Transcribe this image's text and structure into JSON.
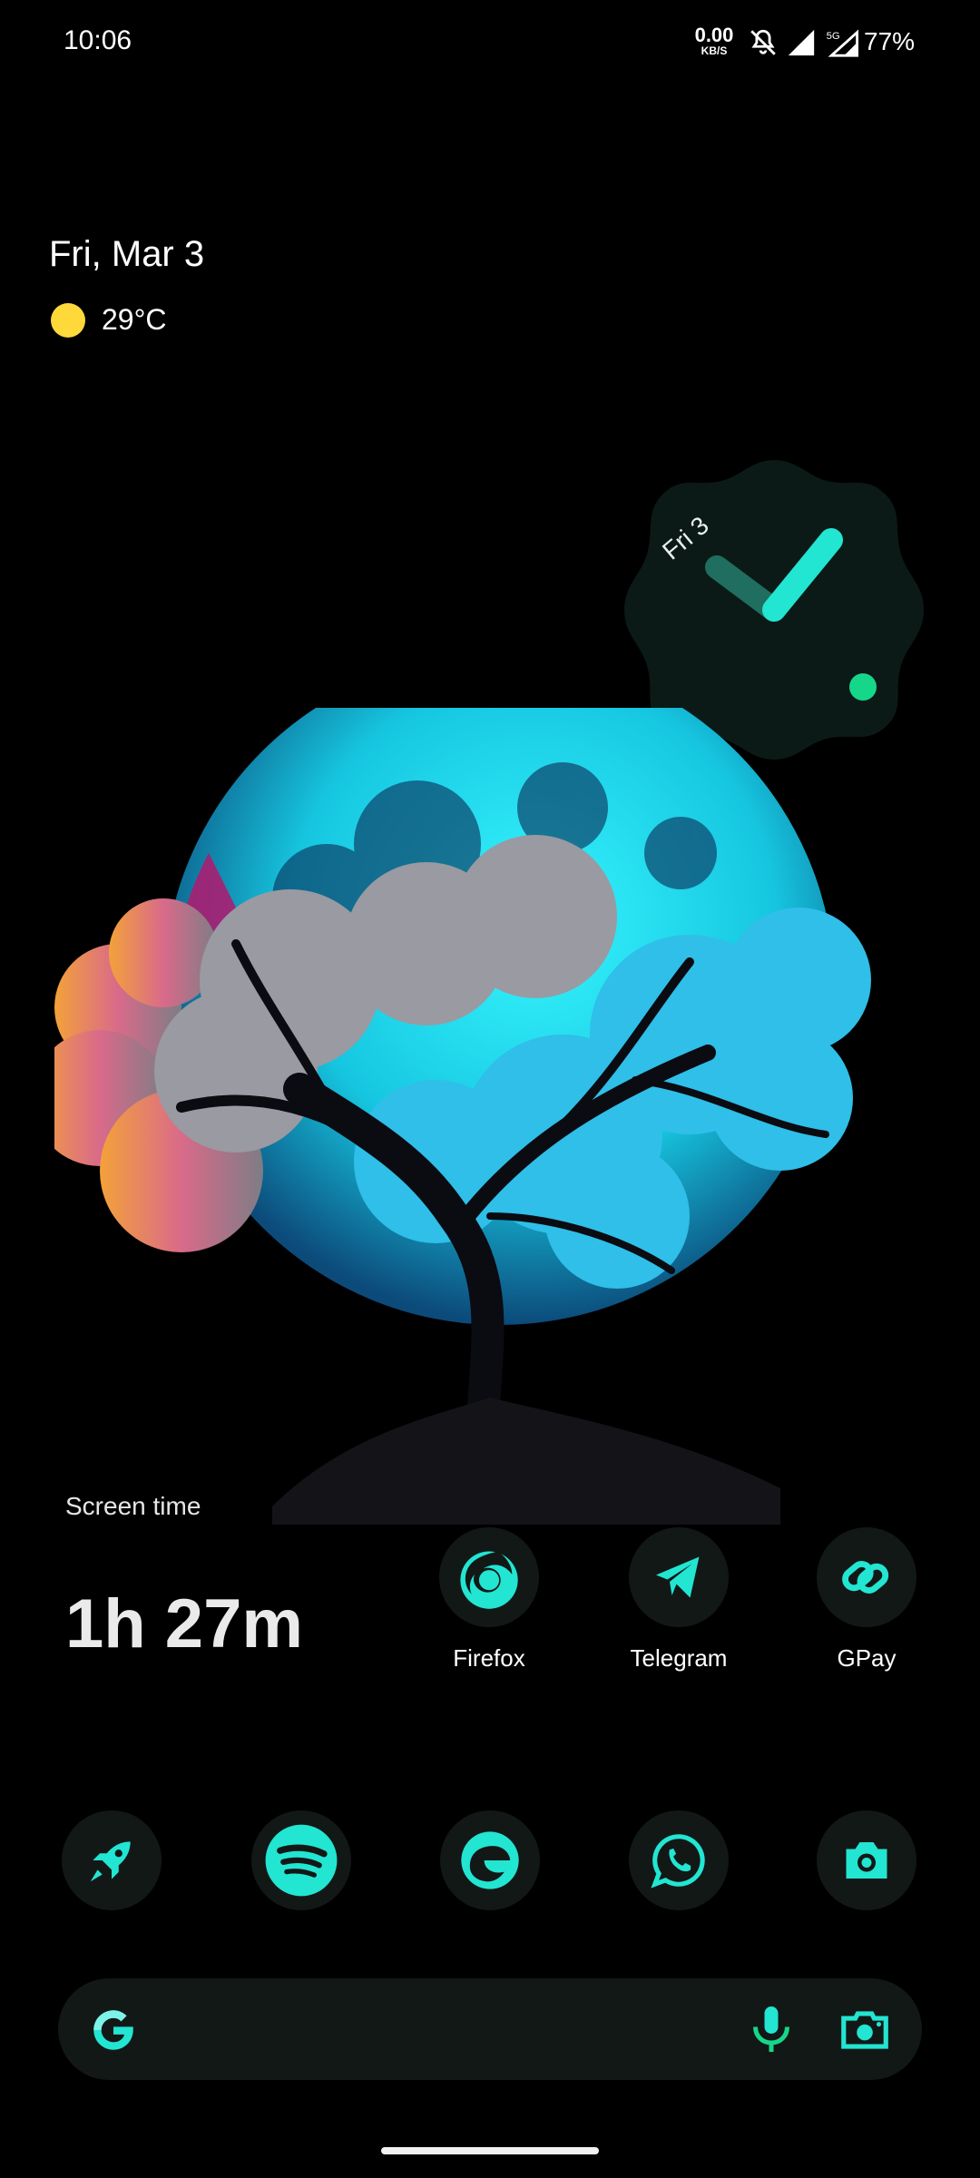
{
  "status": {
    "time": "10:06",
    "net_speed_value": "0.00",
    "net_speed_unit": "KB/S",
    "network_type": "5G",
    "battery": "77%"
  },
  "glance": {
    "date": "Fri, Mar 3",
    "weather_icon": "sun-icon",
    "temperature": "29°C"
  },
  "clock_widget": {
    "date": "Fri 3"
  },
  "screen_time": {
    "label": "Screen time",
    "value": "1h 27m"
  },
  "apps_row": [
    {
      "label": "Firefox",
      "icon": "firefox-icon"
    },
    {
      "label": "Telegram",
      "icon": "telegram-icon"
    },
    {
      "label": "GPay",
      "icon": "gpay-icon"
    }
  ],
  "dock": [
    {
      "icon": "rocket-icon"
    },
    {
      "icon": "spotify-icon"
    },
    {
      "icon": "edge-icon"
    },
    {
      "icon": "whatsapp-icon"
    },
    {
      "icon": "camera-icon"
    }
  ],
  "search": {
    "logo": "google-icon",
    "mic": "mic-icon",
    "lens": "lens-icon"
  },
  "colors": {
    "accent": "#22e5d2",
    "widget_bg": "#0b1a16",
    "icon_bg": "#121816",
    "sun": "#ffd83a",
    "dot": "#16d68a"
  }
}
